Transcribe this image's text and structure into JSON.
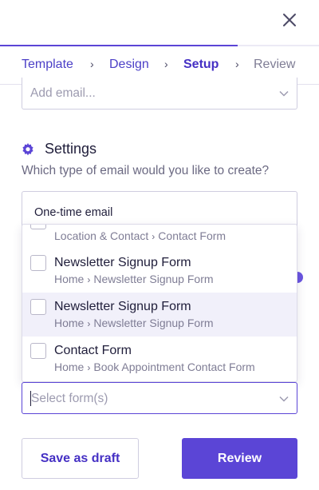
{
  "header": {
    "close_icon": "close-icon",
    "progress_fraction": 0.745
  },
  "steps": [
    {
      "label": "Template",
      "state": "done"
    },
    {
      "label": "Design",
      "state": "done"
    },
    {
      "label": "Setup",
      "state": "current"
    },
    {
      "label": "Review",
      "state": "future"
    }
  ],
  "email_field": {
    "placeholder": "Add email..."
  },
  "settings": {
    "title": "Settings",
    "subtitle": "Which type of email would you like to create?",
    "icon": "gear-icon",
    "selected_type": "One-time email"
  },
  "dropdown": {
    "partial_item_path": [
      "Location & Contact",
      "Contact Form"
    ],
    "items": [
      {
        "name": "Newsletter Signup Form",
        "path": [
          "Home",
          "Newsletter Signup Form"
        ],
        "checked": false,
        "highlighted": false
      },
      {
        "name": "Newsletter Signup Form",
        "path": [
          "Home",
          "Newsletter Signup Form"
        ],
        "checked": false,
        "highlighted": true
      },
      {
        "name": "Contact Form",
        "path": [
          "Home",
          "Book Appointment Contact Form"
        ],
        "checked": false,
        "highlighted": false
      }
    ]
  },
  "form_select": {
    "placeholder": "Select form(s)"
  },
  "footer": {
    "draft_label": "Save as draft",
    "review_label": "Review"
  },
  "colors": {
    "accent": "#5b45d6",
    "text": "#1f1d3a",
    "muted": "#7f7d95",
    "highlight": "#f1f0fa"
  }
}
